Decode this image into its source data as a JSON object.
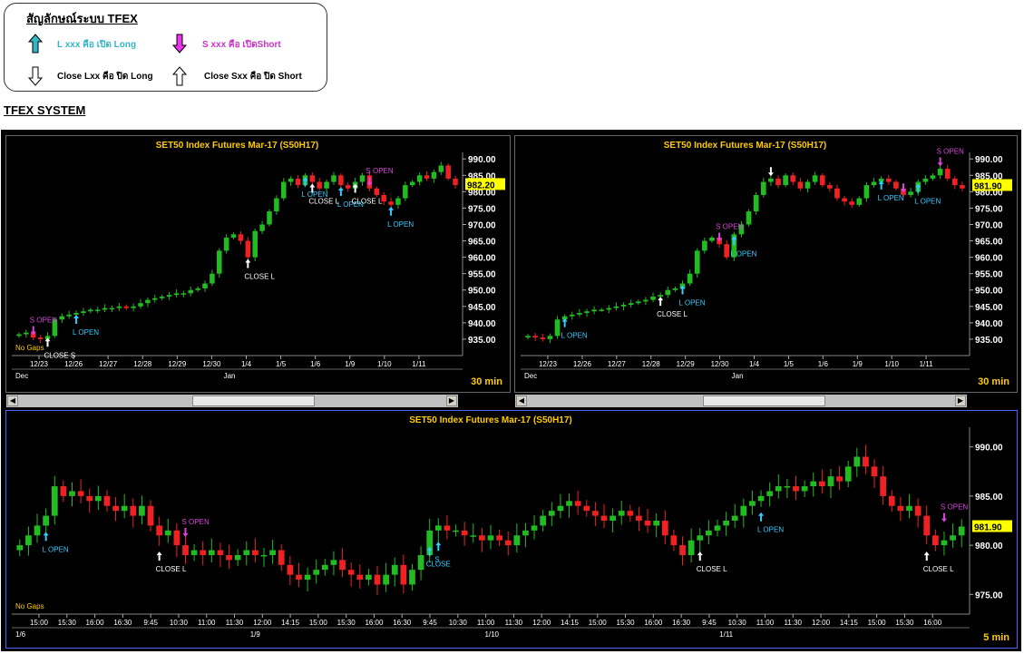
{
  "legend": {
    "title": "สัญลักษณ์ระบบ TFEX",
    "items": [
      {
        "text": "L xxx คือ เปิด Long",
        "color": "#35b6c8",
        "icon": "arrow-up-cyan"
      },
      {
        "text": "S xxx คือ เปิดShort",
        "color": "#cc33cc",
        "icon": "arrow-down-magenta"
      },
      {
        "text": "Close Lxx คือ ปิด Long",
        "color": "#000000",
        "icon": "arrow-down-outline"
      },
      {
        "text": "Close Sxx คือ ปิด Short",
        "color": "#000000",
        "icon": "arrow-up-outline"
      }
    ]
  },
  "system_title": "TFEX SYSTEM",
  "colors": {
    "up": "#22bb22",
    "down": "#ee2222",
    "title": "#ffcc00",
    "axis": "#ffffff",
    "grid": "#555555",
    "long": "#33ccff",
    "short": "#dd44dd",
    "close": "#ffffff",
    "price_box": "#ffff00"
  },
  "chart_data": [
    {
      "type": "candlestick",
      "title": "SET50  Index  Futures  Mar-17  (S50H17)",
      "interval": "30  min",
      "last_price": "982.20",
      "ylim": [
        930,
        992
      ],
      "yticks": [
        "990.00",
        "985.00",
        "980.00",
        "975.00",
        "970.00",
        "965.00",
        "960.00",
        "955.00",
        "950.00",
        "945.00",
        "940.00",
        "935.00"
      ],
      "xticks": [
        "12/23",
        "12/26",
        "12/27",
        "12/28",
        "12/29",
        "12/30",
        "1/4",
        "1/5",
        "1/6",
        "1/9",
        "1/10",
        "1/11"
      ],
      "xticks_lower": [
        "Dec",
        "Jan"
      ],
      "closes": [
        936.5,
        937,
        935.5,
        935,
        936,
        941,
        942,
        942.5,
        943,
        943.5,
        944,
        944,
        944.5,
        944.5,
        945,
        944.5,
        945,
        946,
        947,
        947.5,
        948,
        948.5,
        949,
        949,
        950,
        950.5,
        952,
        955,
        962,
        966,
        967,
        965,
        960,
        968,
        970,
        974,
        978,
        983,
        984,
        982,
        985,
        983,
        981,
        983,
        985,
        982,
        981,
        983,
        985,
        981,
        979,
        977,
        976,
        978,
        982,
        983,
        985,
        984,
        986,
        988,
        984,
        982
      ],
      "annotations": [
        {
          "kind": "short",
          "text": "S  OPEN",
          "index": 2
        },
        {
          "kind": "close",
          "text": "CLOSE  S",
          "index": 4
        },
        {
          "kind": "long",
          "text": "L  OPEN",
          "index": 8
        },
        {
          "kind": "close",
          "text": "CLOSE  L",
          "index": 32
        },
        {
          "kind": "close",
          "text": "CLOSE  L",
          "index": 41
        },
        {
          "kind": "long",
          "text": "L  OPEN",
          "index": 40
        },
        {
          "kind": "long",
          "text": "L  OPEN",
          "index": 45
        },
        {
          "kind": "close",
          "text": "CLOSE  L",
          "index": 47
        },
        {
          "kind": "short",
          "text": "S  OPEN",
          "index": 49
        },
        {
          "kind": "long",
          "text": "L  OPEN",
          "index": 52
        }
      ],
      "footer_left": "No  Gaps"
    },
    {
      "type": "candlestick",
      "title": "SET50  Index  Futures  Mar-17  (S50H17)",
      "interval": "30  min",
      "last_price": "981.90",
      "ylim": [
        930,
        992
      ],
      "yticks": [
        "990.00",
        "985.00",
        "980.00",
        "975.00",
        "970.00",
        "965.00",
        "960.00",
        "955.00",
        "950.00",
        "945.00",
        "940.00",
        "935.00"
      ],
      "xticks": [
        "12/23",
        "12/26",
        "12/27",
        "12/28",
        "12/29",
        "12/30",
        "1/4",
        "1/5",
        "1/6",
        "1/9",
        "1/10",
        "1/11"
      ],
      "xticks_lower": [
        "Dec",
        "Jan"
      ],
      "closes": [
        936,
        935.5,
        935,
        936,
        941,
        942,
        942.5,
        943,
        943.5,
        944,
        944,
        944.5,
        945,
        945.5,
        946,
        946.5,
        947,
        948,
        948.5,
        950,
        950.5,
        952,
        955,
        962,
        965,
        966,
        964,
        960,
        967,
        970,
        974,
        979,
        983,
        984,
        982,
        985,
        983,
        981,
        983,
        985,
        982,
        981,
        978,
        977,
        976,
        978,
        982,
        983,
        984,
        983,
        981,
        979,
        980,
        983,
        984,
        985,
        987,
        984,
        982,
        981
      ],
      "annotations": [
        {
          "kind": "long",
          "text": "L  OPEN",
          "index": 5
        },
        {
          "kind": "close",
          "text": "CLOSE  L",
          "index": 18
        },
        {
          "kind": "long",
          "text": "L  OPEN",
          "index": 21
        },
        {
          "kind": "short",
          "text": "S  OPEN",
          "index": 26
        },
        {
          "kind": "long",
          "text": "L  OPEN",
          "index": 28
        },
        {
          "kind": "close",
          "text": "",
          "index": 33
        },
        {
          "kind": "long",
          "text": "L  OPEN",
          "index": 48
        },
        {
          "kind": "short",
          "text": "",
          "index": 51
        },
        {
          "kind": "long",
          "text": "L  OPEN",
          "index": 53
        },
        {
          "kind": "short",
          "text": "S  OPEN",
          "index": 56
        }
      ],
      "footer_left": ""
    },
    {
      "type": "candlestick",
      "title": "SET50  Index  Futures  Mar-17  (S50H17)",
      "interval": "5  min",
      "last_price": "981.90",
      "ylim": [
        973,
        992
      ],
      "yticks": [
        "990.00",
        "985.00",
        "980.00",
        "975.00"
      ],
      "xticks": [
        "15:00",
        "15:30",
        "16:00",
        "16:30",
        "9:45",
        "10:30",
        "11:00",
        "11:30",
        "12:00",
        "14:15",
        "15:00",
        "15:30",
        "16:00",
        "16:30",
        "9:45",
        "10:30",
        "11:00",
        "11:30",
        "12:00",
        "14:15",
        "15:00",
        "15:30",
        "16:00",
        "16:30",
        "9:45",
        "10:30",
        "11:00",
        "11:30",
        "12:00",
        "14:15",
        "15:00",
        "15:30",
        "16:00"
      ],
      "xticks_lower": [
        "1/6",
        "1/9",
        "1/10",
        "1/11"
      ],
      "closes": [
        980,
        981,
        982,
        983,
        986,
        985,
        985.5,
        985,
        984.5,
        985,
        984,
        983.5,
        984,
        983,
        984,
        982,
        981,
        981.5,
        980,
        979,
        979.5,
        979,
        979.5,
        979,
        978.5,
        979,
        979.5,
        979,
        979,
        979.5,
        978,
        977,
        976.5,
        977,
        977.5,
        978,
        978.5,
        977.5,
        977,
        976.5,
        977,
        976,
        977,
        978,
        976,
        977.5,
        979,
        981.5,
        982,
        981.5,
        981.5,
        981,
        981,
        980.5,
        981,
        980.5,
        980,
        981,
        981.5,
        982,
        983,
        983.5,
        984,
        984.5,
        984,
        983.5,
        983,
        982.5,
        983,
        983.5,
        983,
        982.5,
        982,
        982.5,
        981,
        980,
        979,
        980.5,
        981,
        981.5,
        982,
        982.5,
        983,
        984,
        984.5,
        985,
        985.5,
        986,
        986,
        985.5,
        986,
        986.5,
        986,
        987,
        986.5,
        988,
        989,
        988,
        987,
        985,
        984,
        983.5,
        984,
        983,
        981,
        980,
        980.5,
        981,
        981.9
      ],
      "annotations": [
        {
          "kind": "long",
          "text": "L  OPEN",
          "index": 3
        },
        {
          "kind": "close",
          "text": "CLOSE  L",
          "index": 16
        },
        {
          "kind": "short",
          "text": "S  OPEN",
          "index": 19
        },
        {
          "kind": "long",
          "text": "CLOSE",
          "index": 47
        },
        {
          "kind": "long",
          "text": "S",
          "index": 48
        },
        {
          "kind": "close",
          "text": "CLOSE  L",
          "index": 78
        },
        {
          "kind": "long",
          "text": "L  OPEN",
          "index": 85
        },
        {
          "kind": "close",
          "text": "CLOSE  L",
          "index": 104
        },
        {
          "kind": "short",
          "text": "S  OPEN",
          "index": 106
        }
      ],
      "footer_left": "No  Gaps"
    }
  ]
}
